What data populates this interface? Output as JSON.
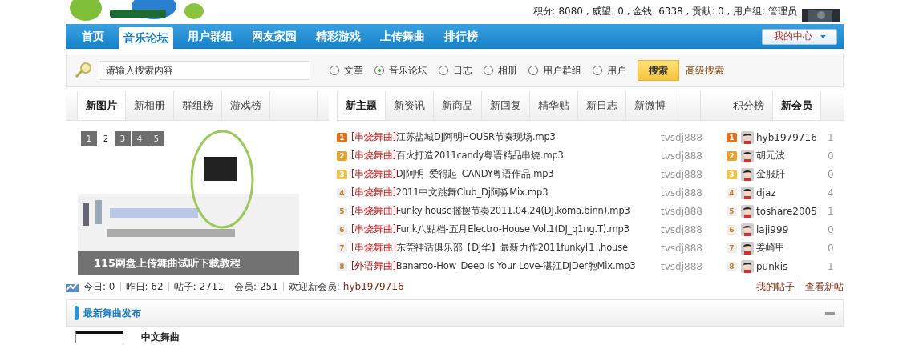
{
  "header": {
    "account_info": "积分: 8080 , 威望: 0 , 金钱: 6338 , 贡献: 0 , 用户组: 管理员"
  },
  "nav": {
    "items": [
      {
        "label": "首页",
        "selected": false
      },
      {
        "label": "音乐论坛",
        "selected": true
      },
      {
        "label": "用户群组",
        "selected": false
      },
      {
        "label": "网友家园",
        "selected": false
      },
      {
        "label": "精彩游戏",
        "selected": false
      },
      {
        "label": "上传舞曲",
        "selected": false
      },
      {
        "label": "排行榜",
        "selected": false
      }
    ],
    "my_center": "我的中心"
  },
  "search": {
    "placeholder": "请输入搜索内容",
    "options": [
      {
        "label": "文章",
        "selected": false
      },
      {
        "label": "音乐论坛",
        "selected": true
      },
      {
        "label": "日志",
        "selected": false
      },
      {
        "label": "相册",
        "selected": false
      },
      {
        "label": "用户群组",
        "selected": false
      },
      {
        "label": "用户",
        "selected": false
      }
    ],
    "button": "搜索",
    "advanced": "高级搜索"
  },
  "photo_panel": {
    "tabs": [
      {
        "label": "新图片",
        "selected": true
      },
      {
        "label": "新相册",
        "selected": false
      },
      {
        "label": "群组榜",
        "selected": false
      },
      {
        "label": "游戏榜",
        "selected": false
      }
    ],
    "pages": [
      {
        "label": "1",
        "selected": false
      },
      {
        "label": "2",
        "selected": true
      },
      {
        "label": "3",
        "selected": false
      },
      {
        "label": "4",
        "selected": false
      },
      {
        "label": "5",
        "selected": false
      }
    ],
    "caption": "115网盘上传舞曲试听下载教程"
  },
  "topics": {
    "tabs": [
      {
        "label": "新主题",
        "selected": true
      },
      {
        "label": "新资讯",
        "selected": false
      },
      {
        "label": "新商品",
        "selected": false
      },
      {
        "label": "新回复",
        "selected": false
      },
      {
        "label": "精华贴",
        "selected": false
      },
      {
        "label": "新日志",
        "selected": false
      },
      {
        "label": "新微博",
        "selected": false
      }
    ],
    "rows": [
      {
        "rank": "1",
        "color": "#e0701e",
        "category": "[串烧舞曲]",
        "title": "江苏盐城DJ阿明HOUSR节奏现场.mp3",
        "author": "tvsdj888"
      },
      {
        "rank": "2",
        "color": "#e8a22a",
        "category": "[串烧舞曲]",
        "title": "百火打造2011candy粤语精品串烧.mp3",
        "author": "tvsdj888"
      },
      {
        "rank": "3",
        "color": "#f0c452",
        "category": "[串烧舞曲]",
        "title": "DJ阿明_爱得起_CANDY粤语作品.mp3",
        "author": "tvsdj888"
      },
      {
        "rank": "4",
        "color": "#eeeeee",
        "category": "[串烧舞曲]",
        "title": "2011中文跳舞Club_Dj阿淼Mix.mp3",
        "author": "tvsdj888"
      },
      {
        "rank": "5",
        "color": "#eeeeee",
        "category": "[串烧舞曲]",
        "title": "Funky house摇摆节奏2011.04.24(DJ.koma.binn).mp3",
        "author": "tvsdj888"
      },
      {
        "rank": "6",
        "color": "#eeeeee",
        "category": "[串烧舞曲]",
        "title": "Funk八點档-五月Electro-House Vol.1(DJ_q1ng.T).mp3",
        "author": "tvsdj888"
      },
      {
        "rank": "7",
        "color": "#eeeeee",
        "category": "[串烧舞曲]",
        "title": "东莞神话俱乐部【DJ华】最新力作2011funky[1].house",
        "author": "tvsdj888"
      },
      {
        "rank": "8",
        "color": "#eeeeee",
        "category": "[外语舞曲]",
        "title": "Banaroo-How_Deep Is Your Love-湛江DJDer胞Mix.mp3",
        "author": "tvsdj888"
      }
    ]
  },
  "members": {
    "tabs": [
      {
        "label": "积分榜",
        "selected": false
      },
      {
        "label": "新会员",
        "selected": true
      }
    ],
    "rows": [
      {
        "rank": "1",
        "color": "#e0701e",
        "name": "hyb1979716",
        "count": "1"
      },
      {
        "rank": "2",
        "color": "#e8a22a",
        "name": "胡元波",
        "count": "0"
      },
      {
        "rank": "3",
        "color": "#f0c452",
        "name": "金服肝",
        "count": "0"
      },
      {
        "rank": "4",
        "color": "#eeeeee",
        "name": "djaz",
        "count": "4"
      },
      {
        "rank": "5",
        "color": "#eeeeee",
        "name": "toshare2005",
        "count": "1"
      },
      {
        "rank": "6",
        "color": "#eeeeee",
        "name": "laji999",
        "count": "0"
      },
      {
        "rank": "7",
        "color": "#eeeeee",
        "name": "姜崎甲",
        "count": "0"
      },
      {
        "rank": "8",
        "color": "#eeeeee",
        "name": "punkis",
        "count": "1"
      }
    ]
  },
  "stats": {
    "items": [
      "今日: 0",
      "昨日: 62",
      "帖子: 2711",
      "会员: 251"
    ],
    "welcome": "欢迎新会员:",
    "new_member": "hyb1979716",
    "links": [
      "我的帖子",
      "查看新帖"
    ]
  },
  "section": {
    "title": "最新舞曲发布",
    "item": "中文舞曲"
  }
}
